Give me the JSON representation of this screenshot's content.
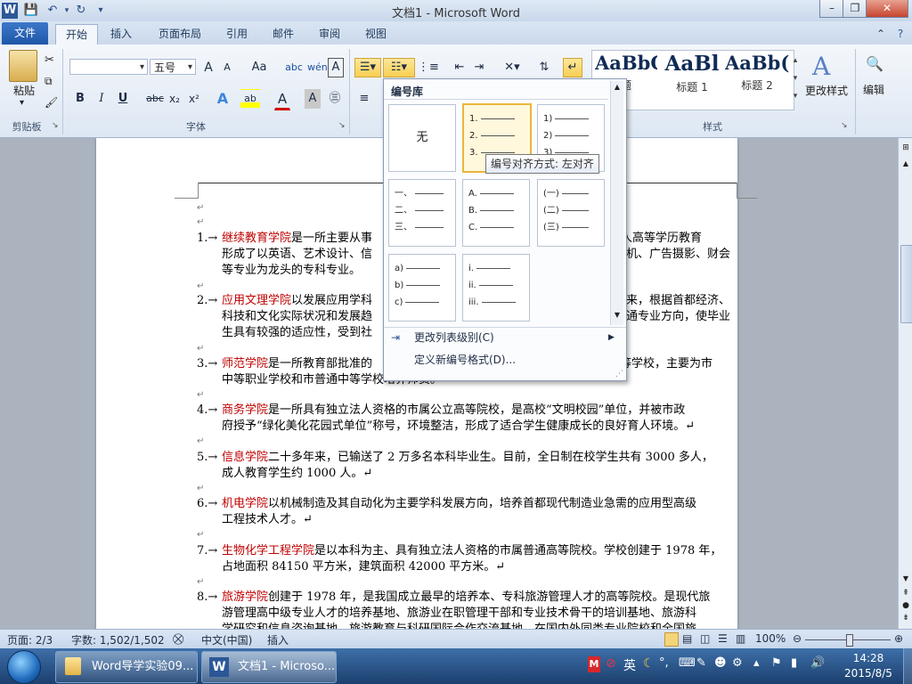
{
  "window": {
    "title": "文档1 - Microsoft Word",
    "word_icon": "W",
    "controls": [
      "–",
      "❐",
      "✕"
    ]
  },
  "ribbon_tabs": [
    "文件",
    "开始",
    "插入",
    "页面布局",
    "引用",
    "邮件",
    "审阅",
    "视图"
  ],
  "clipboard": {
    "paste_label": "粘贴",
    "group_label": "剪贴板"
  },
  "font": {
    "name_value": "",
    "size_value": "五号",
    "grow": "A",
    "shrink": "A",
    "change_case": "Aa",
    "clear": "A",
    "bold": "B",
    "italic": "I",
    "underline": "U",
    "strike": "abc",
    "subscript": "x₂",
    "superscript": "x²",
    "text_effect": "A",
    "highlight": "ab",
    "font_color": "A",
    "char_shading": "A",
    "group_label": "字体"
  },
  "styles": {
    "items": [
      {
        "preview": "AaBbC",
        "caption": "题"
      },
      {
        "preview": "AaBl",
        "caption": "标题 1"
      },
      {
        "preview": "AaBb(",
        "caption": "标题 2"
      }
    ],
    "change_styles": "更改样式",
    "group_label": "样式"
  },
  "editing": {
    "label": "编辑"
  },
  "numbering_library": {
    "header": "编号库",
    "none_label": "无",
    "formats": [
      [
        "1.",
        "2.",
        "3."
      ],
      [
        "1)",
        "2)",
        "3)"
      ],
      [
        "一、",
        "二、",
        "三、"
      ],
      [
        "A.",
        "B.",
        "C."
      ],
      [
        "(一)",
        "(二)",
        "(三)"
      ],
      [
        "a)",
        "b)",
        "c)"
      ],
      [
        "i.",
        "ii.",
        "iii."
      ]
    ],
    "tooltip": "编号对齐方式: 左对齐",
    "menu": [
      {
        "label": "更改列表级别(C)",
        "icon": "indent-icon"
      },
      {
        "label": "定义新编号格式(D)..."
      }
    ]
  },
  "document": {
    "paragraphs": [
      {
        "num": "1.→",
        "college": "继续教育学院",
        "rest": "是一所主要从事",
        "rest2": "的成人高等学历教育",
        "line2a": "形成了以英语、艺术设计、信",
        "line2b": "机、广告摄影、财会",
        "line3": "等专业为龙头的专科专业。"
      },
      {
        "num": "2.→",
        "college": "应用文理学院",
        "rest": "以发展应用学科",
        "rest2": "来，根据首都经济、",
        "line2a": "科技和文化实际状况和发展趋",
        "line2b": "通专业方向，使毕业",
        "line3": "生具有较强的适应性，受到社"
      },
      {
        "num": "3.→",
        "college": "师范学院",
        "rest": "是一所教育部批准的",
        "rest2": "高等学校，主要为市",
        "line2a": "中等职业学校和市普通中等学校培养师资。",
        "line2b": "",
        "line3": ""
      },
      {
        "num": "4.→",
        "college": "商务学院",
        "rest": "是一所具有独立法人资格的市属公立高等院校，是高校“文明校园”单位，并被市政",
        "rest2": "",
        "line2a": "府授予“绿化美化花园式单位”称号，环境整洁，形成了适合学生健康成长的良好育人环境。↵",
        "line2b": "",
        "line3": ""
      },
      {
        "num": "5.→",
        "college": "信息学院",
        "rest": "二十多年来，已输送了 2 万多名本科毕业生。目前，全日制在校学生共有 3000 多人，",
        "rest2": "",
        "line2a": "成人教育学生约 1000 人。↵",
        "line2b": "",
        "line3": ""
      },
      {
        "num": "6.→",
        "college": "机电学院",
        "rest": "以机械制造及其自动化为主要学科发展方向，培养首都现代制造业急需的应用型高级",
        "rest2": "",
        "line2a": "工程技术人才。↵",
        "line2b": "",
        "line3": ""
      },
      {
        "num": "7.→",
        "college": "生物化学工程学院",
        "rest": "是以本科为主、具有独立法人资格的市属普通高等院校。学校创建于 1978 年，",
        "rest2": "",
        "line2a": "占地面积 84150 平方米，建筑面积 42000 平方米。↵",
        "line2b": "",
        "line3": ""
      },
      {
        "num": "8.→",
        "college": "旅游学院",
        "rest": "创建于 1978 年，是我国成立最早的培养本、专科旅游管理人才的高等院校。是现代旅",
        "rest2": "",
        "line2a": "游管理高中级专业人才的培养基地、旅游业在职管理干部和专业技术骨干的培训基地、旅游科",
        "line2b": "",
        "line3": "学研究和信息咨询基地，旅游教育与科研国际合作交流基地，在国内外同类专业院校和全国旅"
      }
    ],
    "para_mark": "↵"
  },
  "statusbar": {
    "page": "页面: 2/3",
    "words": "字数: 1,502/1,502",
    "language": "中文(中国)",
    "mode": "插入",
    "zoom": "100%"
  },
  "taskbar": {
    "items": [
      {
        "label": "Word导学实验09...",
        "icon": "folder-icon"
      },
      {
        "label": "文档1 - Microso...",
        "icon": "word-icon"
      }
    ],
    "ime": "英",
    "time": "14:28",
    "date": "2015/8/5"
  }
}
